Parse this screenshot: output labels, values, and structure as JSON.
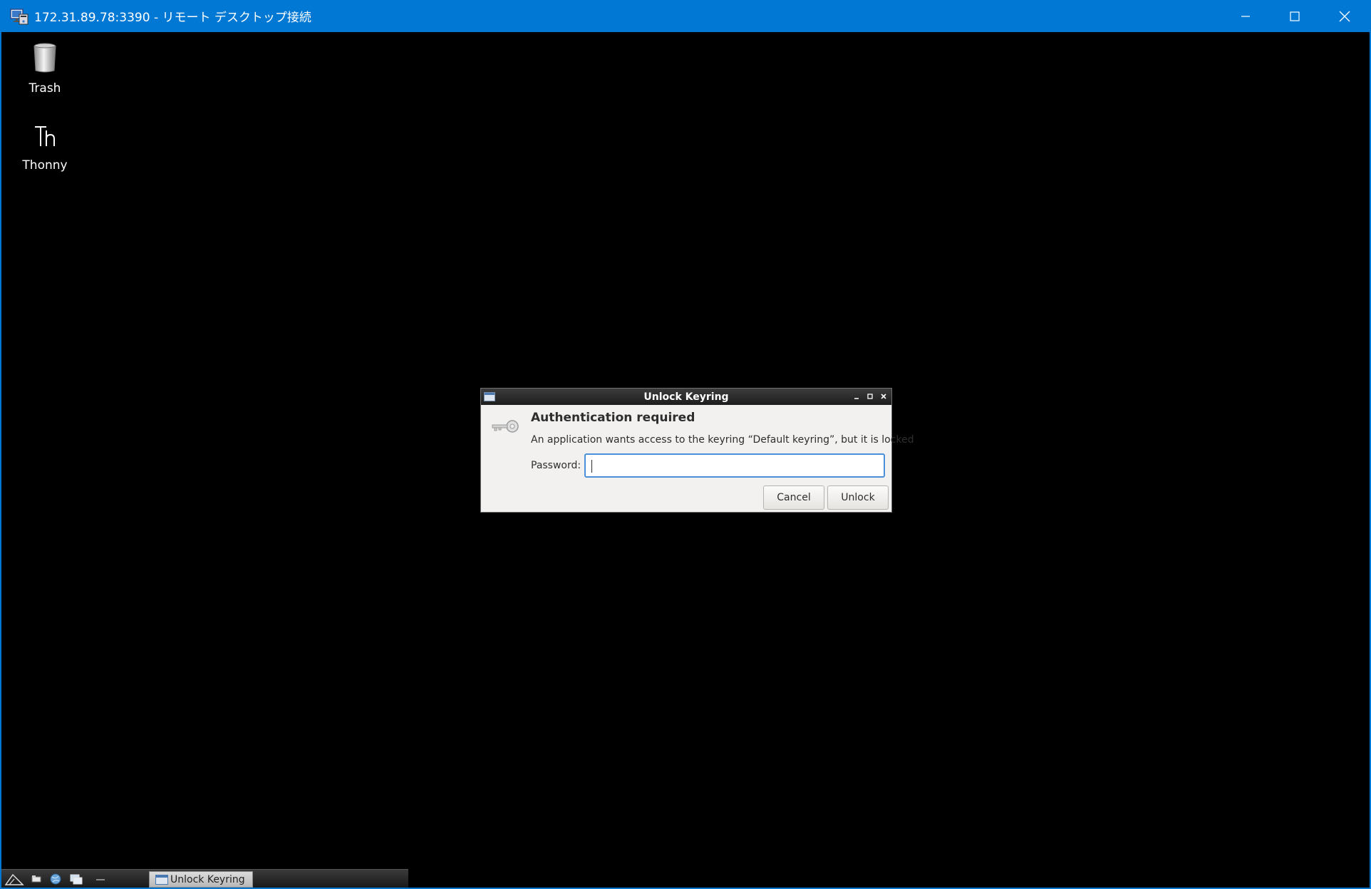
{
  "rdp": {
    "title": "172.31.89.78:3390 - リモート デスクトップ接続",
    "colors": {
      "titlebar": "#0078d4"
    }
  },
  "desktop": {
    "icons": [
      {
        "label": "Trash",
        "icon": "trash-icon"
      },
      {
        "label": "Thonny",
        "icon": "thonny-icon"
      }
    ]
  },
  "dialog": {
    "title": "Unlock Keyring",
    "heading": "Authentication required",
    "message": "An application wants access to the keyring “Default keyring”, but it is locked",
    "password_label": "Password:",
    "password_value": "",
    "cancel_label": "Cancel",
    "unlock_label": "Unlock",
    "focus_color": "#4a90d9"
  },
  "taskbar": {
    "task_label": "Unlock Keyring"
  }
}
